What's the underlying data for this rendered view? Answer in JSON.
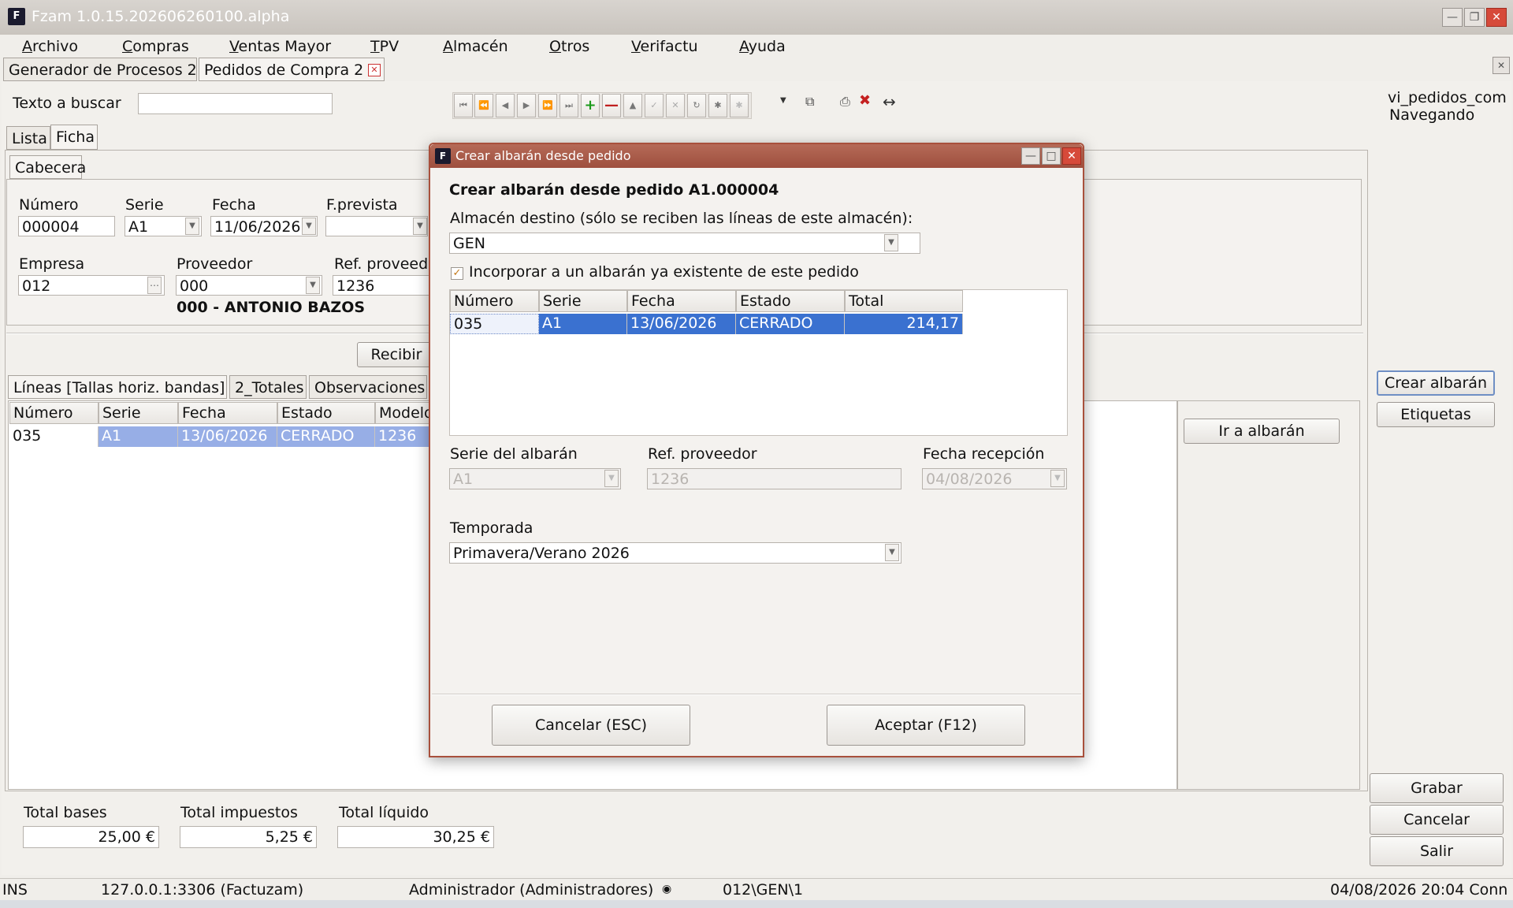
{
  "window": {
    "title": "Fzam 1.0.15.202606260100.alpha",
    "logo": "F"
  },
  "menu": [
    "Archivo",
    "Compras",
    "Ventas Mayor",
    "TPV",
    "Almacén",
    "Otros",
    "Verifactu",
    "Ayuda"
  ],
  "doc_tabs": [
    {
      "label": "Generador de Procesos 2"
    },
    {
      "label": "Pedidos de Compra 2"
    }
  ],
  "search": {
    "label": "Texto a buscar",
    "value": ""
  },
  "view_info": {
    "line1": "vi_pedidos_com",
    "line2": "Navegando"
  },
  "view_tabs": [
    "Lista",
    "Ficha"
  ],
  "header_tab": "Cabecera",
  "form": {
    "numero_label": "Número",
    "numero": "000004",
    "serie_label": "Serie",
    "serie": "A1",
    "fecha_label": "Fecha",
    "fecha": "11/06/2026",
    "fprevista_label": "F.prevista",
    "fprevista": "",
    "empresa_label": "Empresa",
    "empresa": "012",
    "proveedor_label": "Proveedor",
    "proveedor": "000",
    "refprov_label": "Ref. proveedo",
    "refprov": "1236",
    "proveedor_name": "000 - ANTONIO BAZOS"
  },
  "recibir_button": "Recibir",
  "lines_tabs": [
    "Líneas [Tallas horiz. bandas]",
    "2_Totales",
    "Observaciones"
  ],
  "grid": {
    "columns": [
      "Número",
      "Serie",
      "Fecha",
      "Estado",
      "Modelo"
    ],
    "rows": [
      {
        "numero": "035",
        "serie": "A1",
        "fecha": "13/06/2026",
        "estado": "CERRADO",
        "modelo": "1236"
      }
    ]
  },
  "side_buttons": {
    "crear_albaran": "Crear albarán",
    "etiquetas": "Etiquetas",
    "ir_albaran": "Ir a albarán"
  },
  "action_buttons": {
    "grabar": "Grabar",
    "cancelar": "Cancelar",
    "salir": "Salir"
  },
  "totals": {
    "bases_label": "Total bases",
    "bases": "25,00 €",
    "impuestos_label": "Total impuestos",
    "impuestos": "5,25 €",
    "liquido_label": "Total líquido",
    "liquido": "30,25 €"
  },
  "status": {
    "mode": "INS",
    "db": "127.0.0.1:3306 (Factuzam)",
    "user": "Administrador (Administradores)",
    "path": "012\\GEN\\1",
    "datetime": "04/08/2026 20:04 Conn"
  },
  "dialog": {
    "title": "Crear albarán desde pedido",
    "heading": "Crear albarán desde pedido A1.000004",
    "almacen_label": "Almacén destino (sólo se reciben las líneas de este almacén):",
    "almacen": "GEN",
    "incorporar_label": "Incorporar a un albarán ya existente de este pedido",
    "incorporar_checked": true,
    "grid": {
      "columns": [
        "Número",
        "Serie",
        "Fecha",
        "Estado",
        "Total"
      ],
      "rows": [
        {
          "numero": "035",
          "serie": "A1",
          "fecha": "13/06/2026",
          "estado": "CERRADO",
          "total": "214,17"
        }
      ]
    },
    "serie_label": "Serie del albarán",
    "serie": "A1",
    "refprov_label": "Ref. proveedor",
    "refprov": "1236",
    "fecha_label": "Fecha recepción",
    "fecha": "04/08/2026",
    "temporada_label": "Temporada",
    "temporada": "Primavera/Verano 2026",
    "cancel_button": "Cancelar (ESC)",
    "accept_button": "Aceptar (F12)"
  },
  "colors": {
    "title_bar": "#c9c4be",
    "dialog_title": "#a8503c",
    "selection": "#3a71d0",
    "selection_light": "#97aee6",
    "close_button": "#d64a3a"
  }
}
